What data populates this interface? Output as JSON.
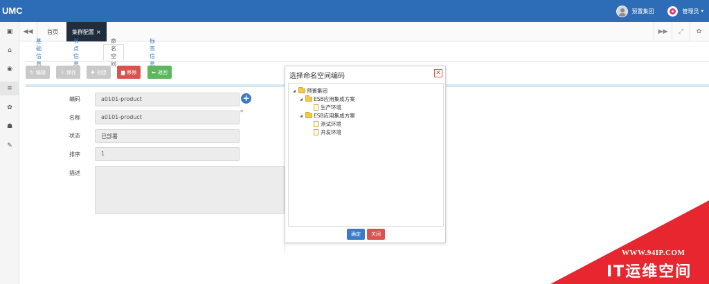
{
  "app": {
    "brand": "UMC"
  },
  "user": {
    "org": "预置集团",
    "admin": "管理员",
    "caret": "▾"
  },
  "sidebar": {
    "items": [
      {
        "icon": "id-card-icon",
        "glyph": "▣"
      },
      {
        "icon": "bank-icon",
        "glyph": "⌂"
      },
      {
        "icon": "eye-icon",
        "glyph": "◉"
      },
      {
        "icon": "list-icon",
        "glyph": "≡"
      },
      {
        "icon": "gear-icon",
        "glyph": "✿"
      },
      {
        "icon": "sitemap-icon",
        "glyph": "☗"
      },
      {
        "icon": "wrench-icon",
        "glyph": "✎"
      }
    ]
  },
  "tabbar": {
    "back_glyph": "◀◀",
    "tabs": [
      {
        "label": "首页"
      },
      {
        "label": "集群配置",
        "close": "×"
      }
    ],
    "forward_glyph": "▶▶",
    "expand_glyph": "⤢",
    "settings_glyph": "✿"
  },
  "subtabs": [
    "基础信息",
    "节点信息",
    "命名空间",
    "标签信息"
  ],
  "toolbar": {
    "edit": {
      "label": "编辑",
      "glyph": "↻"
    },
    "save": {
      "label": "保存",
      "glyph": "⇩"
    },
    "create": {
      "label": "创建",
      "glyph": "✚"
    },
    "remove": {
      "label": "移除",
      "glyph": "▆"
    },
    "back": {
      "label": "返回",
      "glyph": "⬅"
    }
  },
  "form": {
    "code": {
      "label": "编码",
      "value": "a0101-product"
    },
    "name": {
      "label": "名称",
      "value": "a0101-product",
      "required": "*"
    },
    "status": {
      "label": "状态",
      "value": "已部署"
    },
    "order": {
      "label": "排序",
      "value": "1"
    },
    "desc": {
      "label": "描述",
      "value": ""
    },
    "add_glyph": "+"
  },
  "modal": {
    "title": "选择命名空间编码",
    "close_glyph": "✕",
    "tree": [
      {
        "label": "预置集团",
        "type": "folder",
        "level": 0
      },
      {
        "label": "ESB应用集成方案",
        "type": "folder",
        "level": 1
      },
      {
        "label": "生产环境",
        "type": "doc",
        "level": 2
      },
      {
        "label": "ESB应用集成方案",
        "type": "folder",
        "level": 1
      },
      {
        "label": "测试环境",
        "type": "doc",
        "level": 2
      },
      {
        "label": "开发环境",
        "type": "doc",
        "level": 2
      }
    ],
    "expand_glyph": "◢",
    "ok": "确定",
    "cancel": "关闭"
  },
  "watermark": {
    "url": "WWW.94IP.COM",
    "text": "IT运维空间",
    "color": "#e8262f"
  }
}
